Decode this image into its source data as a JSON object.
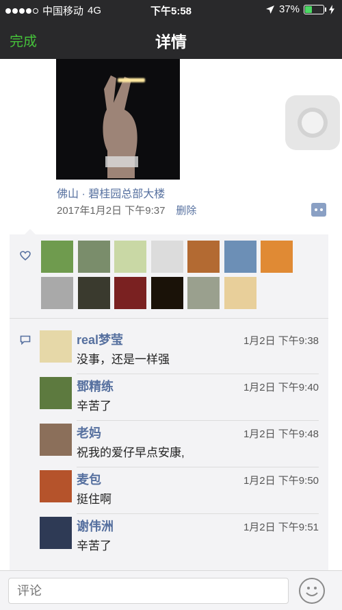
{
  "status_bar": {
    "carrier": "中国移动",
    "network": "4G",
    "time": "下午5:58",
    "battery_percent": "37%",
    "battery_level": 0.37,
    "battery_color": "#4cd964"
  },
  "nav": {
    "done_label": "完成",
    "title": "详情",
    "done_color": "#45c13a"
  },
  "post": {
    "location": "佛山 · 碧桂园总部大楼",
    "date": "2017年1月2日 下午9:37",
    "delete_label": "删除"
  },
  "likes": {
    "icon": "heart-icon",
    "avatars": [
      "#6f9b4e",
      "#7a8d6b",
      "#c9d8a5",
      "#dcdcdc",
      "#b36a32",
      "#6c8fb6",
      "#e08a34",
      "#a9a9a9",
      "#3a3a2e",
      "#7a2121",
      "#1a1208",
      "#9aa08e",
      "#e8cf9a"
    ]
  },
  "comments": [
    {
      "name": "real梦莹",
      "time": "1月2日 下午9:38",
      "text": "没事，还是一样强",
      "avatar_color": "#e6d8a8"
    },
    {
      "name": "鄧精练",
      "time": "1月2日 下午9:40",
      "text": "辛苦了",
      "avatar_color": "#5d7a3f"
    },
    {
      "name": "老妈",
      "time": "1月2日 下午9:48",
      "text": "祝我的爱仔早点安康,",
      "avatar_color": "#8b6f5a"
    },
    {
      "name": "麦包",
      "time": "1月2日 下午9:50",
      "text": "挺住啊",
      "avatar_color": "#b5532b"
    },
    {
      "name": "谢伟洲",
      "time": "1月2日 下午9:51",
      "text": "辛苦了",
      "avatar_color": "#2e3a55"
    }
  ],
  "input": {
    "placeholder": "评论",
    "emoji_icon": "smiley-icon"
  }
}
